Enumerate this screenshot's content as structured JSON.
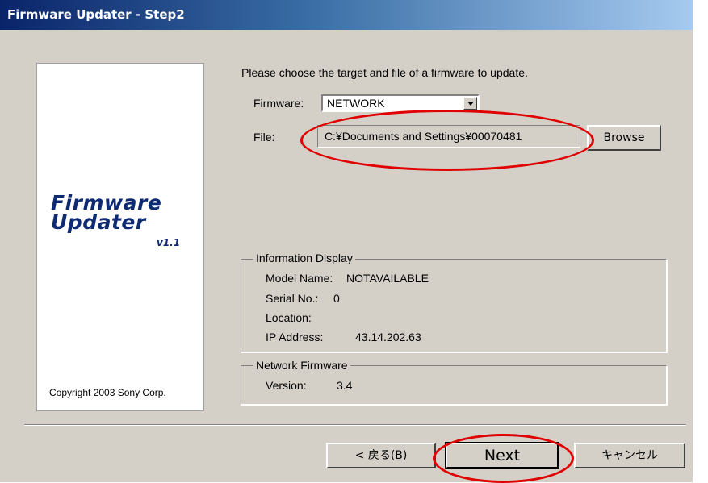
{
  "window": {
    "title": "Firmware Updater - Step2"
  },
  "logo": {
    "line1": "Firmware",
    "line2": "Updater",
    "version": "v1.1",
    "copyright": "Copyright 2003 Sony Corp."
  },
  "form": {
    "instruction": "Please choose the target and file of a firmware to update.",
    "firmware_label": "Firmware:",
    "firmware_value": "NETWORK",
    "file_label": "File:",
    "file_value": "C:¥Documents and Settings¥00070481",
    "browse_label": "Browse"
  },
  "info_display": {
    "title": "Information Display",
    "model_label": "Model Name:",
    "model_value": "NOTAVAILABLE",
    "serial_label": "Serial No.:",
    "serial_value": "0",
    "location_label": "Location:",
    "location_value": "",
    "ip_label": "IP Address:",
    "ip_value": "43.14.202.63"
  },
  "network_firmware": {
    "title": "Network Firmware",
    "version_label": "Version:",
    "version_value": "3.4"
  },
  "footer": {
    "back_label": "< 戻る(B)",
    "next_label": "Next",
    "cancel_label": "キャンセル"
  },
  "annotation_color": "#e00000"
}
